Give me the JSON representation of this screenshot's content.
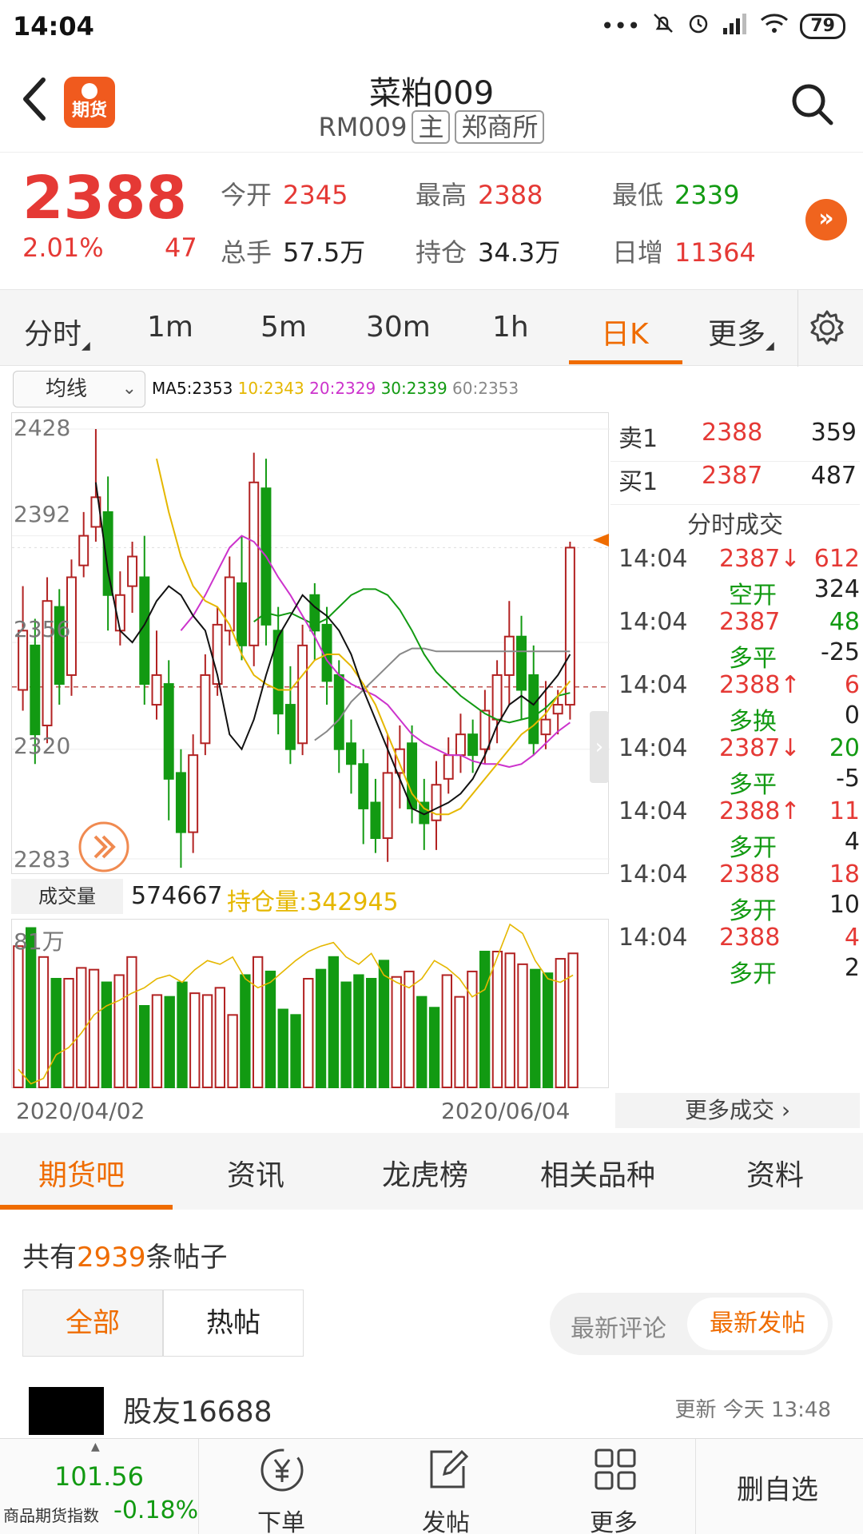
{
  "status_bar": {
    "time": "14:04",
    "battery": "79",
    "icons": [
      "more-dots-icon",
      "bell-off-icon",
      "alarm-icon",
      "signal-icon",
      "wifi-icon",
      "battery-icon"
    ]
  },
  "header": {
    "title": "菜粕009",
    "code": "RM009",
    "tag_main": "主",
    "exchange": "郑商所",
    "logo_text": "期货"
  },
  "quote": {
    "price": "2388",
    "change_pct": "2.01%",
    "change": "47",
    "open_label": "今开",
    "open": "2345",
    "high_label": "最高",
    "high": "2388",
    "low_label": "最低",
    "low": "2339",
    "volume_label": "总手",
    "volume": "57.5万",
    "oi_label": "持仓",
    "oi": "34.3万",
    "daily_inc_label": "日增",
    "daily_inc": "11364",
    "colors": {
      "up": "#e53935",
      "down": "#129a12"
    }
  },
  "period_tabs": [
    "分时",
    "1m",
    "5m",
    "30m",
    "1h",
    "日K",
    "更多"
  ],
  "active_period": "日K",
  "ma": {
    "select_label": "均线",
    "ma5": "MA5:2353",
    "ma10": "10:2343",
    "ma20": "20:2329",
    "ma30": "30:2339",
    "ma60": "60:2353",
    "colors": {
      "ma5": "#111111",
      "ma10": "#e5b700",
      "ma20": "#cc33cc",
      "ma30": "#129a12",
      "ma60": "#888888"
    }
  },
  "kline_axis": {
    "labels": [
      "2428",
      "2392",
      "2356",
      "2320",
      "2283"
    ]
  },
  "volume_area": {
    "label": "成交量",
    "volume": "574667",
    "oi": "持仓量:342945",
    "max_label": "81万"
  },
  "dates": {
    "start": "2020/04/02",
    "end": "2020/06/04"
  },
  "order_book": [
    {
      "label": "卖1",
      "price": "2388",
      "qty": "359"
    },
    {
      "label": "买1",
      "price": "2387",
      "qty": "487"
    }
  ],
  "trades_title": "分时成交",
  "trades": [
    {
      "time": "14:04",
      "price": "2387↓",
      "vol": "612",
      "vol_color": "red",
      "nature": "空开",
      "oi": "324"
    },
    {
      "time": "14:04",
      "price": "2387",
      "vol": "48",
      "vol_color": "green",
      "nature": "多平",
      "oi": "-25"
    },
    {
      "time": "14:04",
      "price": "2388↑",
      "vol": "6",
      "vol_color": "red",
      "nature": "多换",
      "oi": "0"
    },
    {
      "time": "14:04",
      "price": "2387↓",
      "vol": "20",
      "vol_color": "green",
      "nature": "多平",
      "oi": "-5"
    },
    {
      "time": "14:04",
      "price": "2388↑",
      "vol": "11",
      "vol_color": "red",
      "nature": "多开",
      "oi": "4"
    },
    {
      "time": "14:04",
      "price": "2388",
      "vol": "18",
      "vol_color": "red",
      "nature": "多开",
      "oi": "10"
    },
    {
      "time": "14:04",
      "price": "2388",
      "vol": "4",
      "vol_color": "red",
      "nature": "多开",
      "oi": "2"
    }
  ],
  "more_trades": "更多成交",
  "bottom_tabs": [
    "期货吧",
    "资讯",
    "龙虎榜",
    "相关品种",
    "资料"
  ],
  "posts": {
    "count_prefix": "共有",
    "count": "2939",
    "count_suffix": "条帖子",
    "filter_all": "全部",
    "filter_hot": "热帖",
    "sort_comment": "最新评论",
    "sort_post": "最新发帖",
    "first_user": "股友16688",
    "first_time": "更新 今天 13:48"
  },
  "bottom_nav": {
    "index_value": "101.56",
    "index_name": "商品期货指数",
    "index_change": "-0.18%",
    "order": "下单",
    "post": "发帖",
    "more": "更多",
    "remove_watch": "删自选"
  },
  "chart_data": [
    {
      "type": "candlestick",
      "title": "菜粕009 日K",
      "x_start": "2020/04/02",
      "x_end": "2020/06/04",
      "ylim": [
        2283,
        2428
      ],
      "candles": [
        [
          2360,
          2340,
          2375,
          2333,
          "u"
        ],
        [
          2355,
          2325,
          2364,
          2315,
          "d"
        ],
        [
          2328,
          2370,
          2378,
          2322,
          "u"
        ],
        [
          2368,
          2342,
          2374,
          2335,
          "d"
        ],
        [
          2345,
          2378,
          2384,
          2338,
          "u"
        ],
        [
          2382,
          2392,
          2400,
          2378,
          "u"
        ],
        [
          2395,
          2405,
          2428,
          2390,
          "u"
        ],
        [
          2400,
          2372,
          2412,
          2360,
          "d"
        ],
        [
          2360,
          2372,
          2380,
          2355,
          "u"
        ],
        [
          2375,
          2385,
          2390,
          2366,
          "u"
        ],
        [
          2378,
          2342,
          2392,
          2335,
          "d"
        ],
        [
          2335,
          2345,
          2360,
          2330,
          "u"
        ],
        [
          2342,
          2310,
          2350,
          2296,
          "d"
        ],
        [
          2312,
          2292,
          2320,
          2280,
          "d"
        ],
        [
          2292,
          2318,
          2325,
          2285,
          "u"
        ],
        [
          2322,
          2345,
          2352,
          2318,
          "u"
        ],
        [
          2342,
          2362,
          2368,
          2338,
          "u"
        ],
        [
          2360,
          2378,
          2385,
          2355,
          "u"
        ],
        [
          2376,
          2355,
          2392,
          2350,
          "d"
        ],
        [
          2355,
          2410,
          2420,
          2348,
          "u"
        ],
        [
          2408,
          2362,
          2418,
          2355,
          "d"
        ],
        [
          2360,
          2332,
          2368,
          2325,
          "d"
        ],
        [
          2335,
          2320,
          2348,
          2315,
          "d"
        ],
        [
          2322,
          2355,
          2362,
          2318,
          "u"
        ],
        [
          2372,
          2360,
          2376,
          2350,
          "d"
        ],
        [
          2362,
          2343,
          2368,
          2335,
          "d"
        ],
        [
          2345,
          2320,
          2350,
          2312,
          "d"
        ],
        [
          2322,
          2315,
          2330,
          2305,
          "d"
        ],
        [
          2315,
          2300,
          2320,
          2288,
          "d"
        ],
        [
          2302,
          2290,
          2310,
          2285,
          "d"
        ],
        [
          2290,
          2312,
          2325,
          2282,
          "u"
        ],
        [
          2312,
          2320,
          2328,
          2300,
          "u"
        ],
        [
          2322,
          2300,
          2328,
          2295,
          "d"
        ],
        [
          2302,
          2295,
          2310,
          2286,
          "d"
        ],
        [
          2296,
          2308,
          2316,
          2286,
          "u"
        ],
        [
          2310,
          2318,
          2324,
          2305,
          "u"
        ],
        [
          2318,
          2325,
          2332,
          2312,
          "u"
        ],
        [
          2325,
          2318,
          2330,
          2312,
          "d"
        ],
        [
          2320,
          2333,
          2340,
          2315,
          "u"
        ],
        [
          2330,
          2345,
          2350,
          2322,
          "u"
        ],
        [
          2345,
          2358,
          2370,
          2335,
          "u"
        ],
        [
          2358,
          2340,
          2365,
          2330,
          "d"
        ],
        [
          2345,
          2322,
          2355,
          2318,
          "d"
        ],
        [
          2325,
          2330,
          2343,
          2320,
          "u"
        ],
        [
          2332,
          2335,
          2340,
          2325,
          "u"
        ],
        [
          2335,
          2388,
          2390,
          2330,
          "u"
        ]
      ],
      "ma5": [
        2410,
        2380,
        2360,
        2356,
        2362,
        2370,
        2375,
        2372,
        2365,
        2360,
        2345,
        2325,
        2320,
        2330,
        2345,
        2358,
        2365,
        2372,
        2368,
        2365,
        2360,
        2352,
        2340,
        2330,
        2320,
        2310,
        2300,
        2298,
        2300,
        2302,
        2305,
        2310,
        2318,
        2328,
        2335,
        2338,
        2335,
        2340,
        2345,
        2352
      ],
      "ma10": [
        2418,
        2400,
        2385,
        2375,
        2370,
        2368,
        2362,
        2352,
        2345,
        2342,
        2340,
        2340,
        2345,
        2350,
        2352,
        2352,
        2348,
        2342,
        2335,
        2325,
        2315,
        2305,
        2300,
        2298,
        2298,
        2300,
        2305,
        2310,
        2315,
        2320,
        2325,
        2328,
        2332,
        2338,
        2343
      ],
      "ma20": [
        2360,
        2365,
        2372,
        2380,
        2388,
        2392,
        2390,
        2385,
        2378,
        2372,
        2365,
        2358,
        2350,
        2345,
        2342,
        2340,
        2338,
        2335,
        2330,
        2325,
        2322,
        2320,
        2318,
        2318,
        2316,
        2315,
        2315,
        2314,
        2315,
        2318,
        2322,
        2326,
        2329
      ],
      "ma30": [
        2363,
        2366,
        2365,
        2366,
        2364,
        2362,
        2364,
        2368,
        2372,
        2374,
        2374,
        2372,
        2367,
        2360,
        2352,
        2346,
        2342,
        2338,
        2335,
        2332,
        2330,
        2329,
        2330,
        2331,
        2334,
        2338,
        2339
      ],
      "ma60": [
        2323,
        2326,
        2330,
        2336,
        2340,
        2344,
        2348,
        2352,
        2354,
        2354,
        2353,
        2353,
        2353,
        2353,
        2353,
        2353,
        2353,
        2353,
        2353,
        2353,
        2353,
        2353
      ]
    },
    {
      "type": "bar",
      "title": "成交量",
      "ylim": [
        0,
        810000
      ],
      "values": [
        78,
        88,
        72,
        60,
        60,
        66,
        65,
        58,
        62,
        72,
        45,
        51,
        50,
        58,
        52,
        51,
        55,
        40,
        62,
        72,
        64,
        43,
        40,
        60,
        65,
        72,
        58,
        62,
        60,
        70,
        61,
        64,
        50,
        44,
        62,
        50,
        64,
        75,
        75,
        74,
        68,
        65,
        63,
        71,
        74
      ],
      "oi_line": [
        10,
        2,
        5,
        18,
        22,
        30,
        40,
        45,
        48,
        52,
        55,
        60,
        62,
        58,
        65,
        70,
        68,
        72,
        60,
        55,
        58,
        64,
        70,
        75,
        78,
        80,
        72,
        68,
        74,
        62,
        58,
        55,
        60,
        70,
        66,
        60,
        50,
        54,
        72,
        90,
        85,
        70,
        60,
        58,
        62
      ]
    }
  ]
}
